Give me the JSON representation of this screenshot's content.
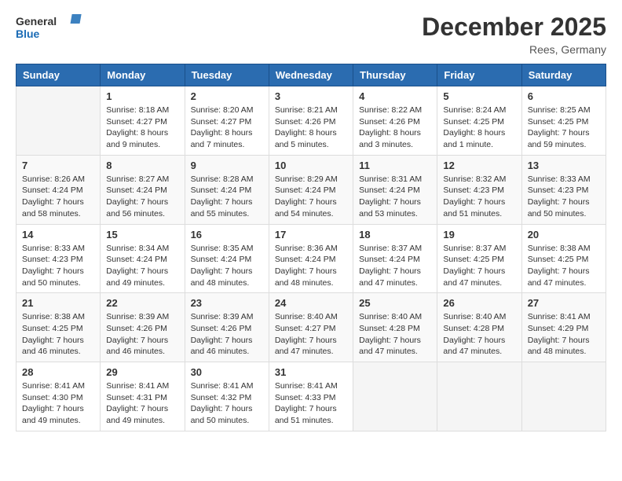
{
  "logo": {
    "general": "General",
    "blue": "Blue"
  },
  "title": "December 2025",
  "location": "Rees, Germany",
  "days_of_week": [
    "Sunday",
    "Monday",
    "Tuesday",
    "Wednesday",
    "Thursday",
    "Friday",
    "Saturday"
  ],
  "weeks": [
    [
      {
        "day": "",
        "info": ""
      },
      {
        "day": "1",
        "info": "Sunrise: 8:18 AM\nSunset: 4:27 PM\nDaylight: 8 hours\nand 9 minutes."
      },
      {
        "day": "2",
        "info": "Sunrise: 8:20 AM\nSunset: 4:27 PM\nDaylight: 8 hours\nand 7 minutes."
      },
      {
        "day": "3",
        "info": "Sunrise: 8:21 AM\nSunset: 4:26 PM\nDaylight: 8 hours\nand 5 minutes."
      },
      {
        "day": "4",
        "info": "Sunrise: 8:22 AM\nSunset: 4:26 PM\nDaylight: 8 hours\nand 3 minutes."
      },
      {
        "day": "5",
        "info": "Sunrise: 8:24 AM\nSunset: 4:25 PM\nDaylight: 8 hours\nand 1 minute."
      },
      {
        "day": "6",
        "info": "Sunrise: 8:25 AM\nSunset: 4:25 PM\nDaylight: 7 hours\nand 59 minutes."
      }
    ],
    [
      {
        "day": "7",
        "info": "Sunrise: 8:26 AM\nSunset: 4:24 PM\nDaylight: 7 hours\nand 58 minutes."
      },
      {
        "day": "8",
        "info": "Sunrise: 8:27 AM\nSunset: 4:24 PM\nDaylight: 7 hours\nand 56 minutes."
      },
      {
        "day": "9",
        "info": "Sunrise: 8:28 AM\nSunset: 4:24 PM\nDaylight: 7 hours\nand 55 minutes."
      },
      {
        "day": "10",
        "info": "Sunrise: 8:29 AM\nSunset: 4:24 PM\nDaylight: 7 hours\nand 54 minutes."
      },
      {
        "day": "11",
        "info": "Sunrise: 8:31 AM\nSunset: 4:24 PM\nDaylight: 7 hours\nand 53 minutes."
      },
      {
        "day": "12",
        "info": "Sunrise: 8:32 AM\nSunset: 4:23 PM\nDaylight: 7 hours\nand 51 minutes."
      },
      {
        "day": "13",
        "info": "Sunrise: 8:33 AM\nSunset: 4:23 PM\nDaylight: 7 hours\nand 50 minutes."
      }
    ],
    [
      {
        "day": "14",
        "info": "Sunrise: 8:33 AM\nSunset: 4:23 PM\nDaylight: 7 hours\nand 50 minutes."
      },
      {
        "day": "15",
        "info": "Sunrise: 8:34 AM\nSunset: 4:24 PM\nDaylight: 7 hours\nand 49 minutes."
      },
      {
        "day": "16",
        "info": "Sunrise: 8:35 AM\nSunset: 4:24 PM\nDaylight: 7 hours\nand 48 minutes."
      },
      {
        "day": "17",
        "info": "Sunrise: 8:36 AM\nSunset: 4:24 PM\nDaylight: 7 hours\nand 48 minutes."
      },
      {
        "day": "18",
        "info": "Sunrise: 8:37 AM\nSunset: 4:24 PM\nDaylight: 7 hours\nand 47 minutes."
      },
      {
        "day": "19",
        "info": "Sunrise: 8:37 AM\nSunset: 4:25 PM\nDaylight: 7 hours\nand 47 minutes."
      },
      {
        "day": "20",
        "info": "Sunrise: 8:38 AM\nSunset: 4:25 PM\nDaylight: 7 hours\nand 47 minutes."
      }
    ],
    [
      {
        "day": "21",
        "info": "Sunrise: 8:38 AM\nSunset: 4:25 PM\nDaylight: 7 hours\nand 46 minutes."
      },
      {
        "day": "22",
        "info": "Sunrise: 8:39 AM\nSunset: 4:26 PM\nDaylight: 7 hours\nand 46 minutes."
      },
      {
        "day": "23",
        "info": "Sunrise: 8:39 AM\nSunset: 4:26 PM\nDaylight: 7 hours\nand 46 minutes."
      },
      {
        "day": "24",
        "info": "Sunrise: 8:40 AM\nSunset: 4:27 PM\nDaylight: 7 hours\nand 47 minutes."
      },
      {
        "day": "25",
        "info": "Sunrise: 8:40 AM\nSunset: 4:28 PM\nDaylight: 7 hours\nand 47 minutes."
      },
      {
        "day": "26",
        "info": "Sunrise: 8:40 AM\nSunset: 4:28 PM\nDaylight: 7 hours\nand 47 minutes."
      },
      {
        "day": "27",
        "info": "Sunrise: 8:41 AM\nSunset: 4:29 PM\nDaylight: 7 hours\nand 48 minutes."
      }
    ],
    [
      {
        "day": "28",
        "info": "Sunrise: 8:41 AM\nSunset: 4:30 PM\nDaylight: 7 hours\nand 49 minutes."
      },
      {
        "day": "29",
        "info": "Sunrise: 8:41 AM\nSunset: 4:31 PM\nDaylight: 7 hours\nand 49 minutes."
      },
      {
        "day": "30",
        "info": "Sunrise: 8:41 AM\nSunset: 4:32 PM\nDaylight: 7 hours\nand 50 minutes."
      },
      {
        "day": "31",
        "info": "Sunrise: 8:41 AM\nSunset: 4:33 PM\nDaylight: 7 hours\nand 51 minutes."
      },
      {
        "day": "",
        "info": ""
      },
      {
        "day": "",
        "info": ""
      },
      {
        "day": "",
        "info": ""
      }
    ]
  ]
}
